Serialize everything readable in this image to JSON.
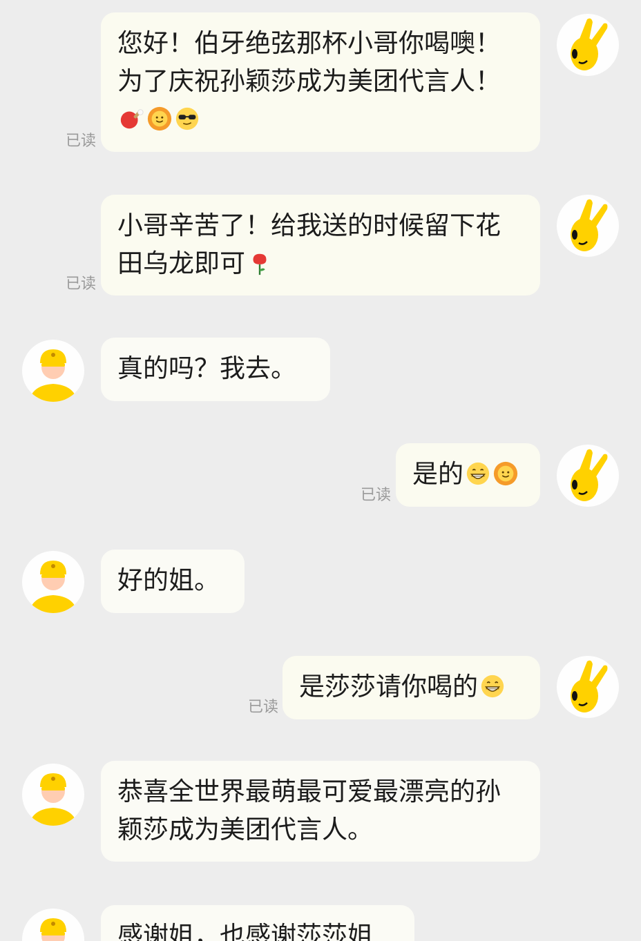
{
  "read_label": "已读",
  "messages": [
    {
      "side": "right",
      "text": "您好！伯牙绝弦那杯小哥你喝噢！为了庆祝孙颖莎成为美团代言人！",
      "emojis": [
        "ping-pong-icon",
        "sun-face-icon",
        "cool-sunglasses-icon"
      ],
      "read": true
    },
    {
      "side": "right",
      "text": "小哥辛苦了！给我送的时候留下花田乌龙即可",
      "emojis": [
        "rose-icon"
      ],
      "read": true
    },
    {
      "side": "left",
      "text": "真的吗？我去。",
      "emojis": [],
      "read": false
    },
    {
      "side": "right",
      "text": "是的",
      "emojis": [
        "grin-icon",
        "sun-face-icon"
      ],
      "read": true
    },
    {
      "side": "left",
      "text": "好的姐。",
      "emojis": [],
      "read": false
    },
    {
      "side": "right",
      "text": "是莎莎请你喝的",
      "emojis": [
        "grin-icon"
      ],
      "read": true
    },
    {
      "side": "left",
      "text": "恭喜全世界最萌最可爱最漂亮的孙颖莎成为美团代言人。",
      "emojis": [],
      "read": false
    },
    {
      "side": "left",
      "text": "感谢姐，也感谢莎莎姐",
      "emojis": [],
      "read": false
    }
  ],
  "colors": {
    "background": "#ededed",
    "bubble": "#fbfbf5",
    "brand_yellow": "#ffd100",
    "read_text": "#9a9a9a"
  }
}
